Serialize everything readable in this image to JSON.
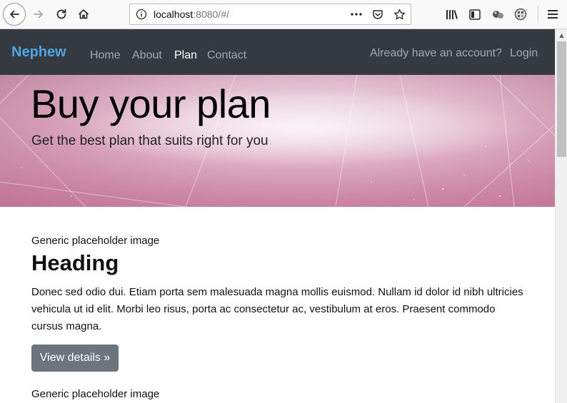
{
  "browser": {
    "url_host": "localhost",
    "url_rest": ":8080/#/",
    "icons": [
      "back-icon",
      "forward-icon",
      "reload-icon",
      "home-icon",
      "info-icon",
      "more-icon",
      "pocket-icon",
      "bookmark-star-icon",
      "library-icon",
      "sidebar-icon",
      "extension-icon",
      "addon-icon",
      "menu-icon"
    ]
  },
  "navbar": {
    "brand": "Nephew",
    "links": [
      {
        "label": "Home",
        "active": false
      },
      {
        "label": "About",
        "active": false
      },
      {
        "label": "Plan",
        "active": true
      },
      {
        "label": "Contact",
        "active": false
      }
    ],
    "account_prompt": "Already have an account?",
    "login": "Login"
  },
  "hero": {
    "title": "Buy your plan",
    "subtitle": "Get the best plan that suits right for you"
  },
  "content": {
    "items": [
      {
        "image_caption": "Generic placeholder image",
        "heading": "Heading",
        "body": "Donec sed odio dui. Etiam porta sem malesuada magna mollis euismod. Nullam id dolor id nibh ultricies vehicula ut id elit. Morbi leo risus, porta ac consectetur ac, vestibulum at eros. Praesent commodo cursus magna.",
        "button": "View details »"
      },
      {
        "image_caption": "Generic placeholder image"
      }
    ]
  },
  "colors": {
    "navbar_bg": "#343a40",
    "brand": "#4fa5e3",
    "button_bg": "#6c757d"
  }
}
